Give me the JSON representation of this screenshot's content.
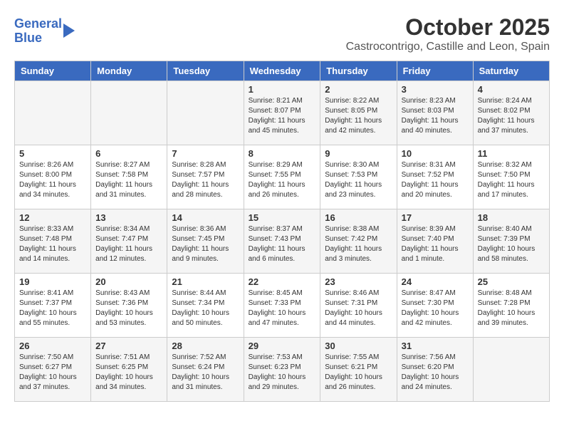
{
  "logo": {
    "line1": "General",
    "line2": "Blue"
  },
  "header": {
    "title": "October 2025",
    "subtitle": "Castrocontrigo, Castille and Leon, Spain"
  },
  "weekdays": [
    "Sunday",
    "Monday",
    "Tuesday",
    "Wednesday",
    "Thursday",
    "Friday",
    "Saturday"
  ],
  "weeks": [
    [
      {
        "day": "",
        "info": ""
      },
      {
        "day": "",
        "info": ""
      },
      {
        "day": "",
        "info": ""
      },
      {
        "day": "1",
        "info": "Sunrise: 8:21 AM\nSunset: 8:07 PM\nDaylight: 11 hours and 45 minutes."
      },
      {
        "day": "2",
        "info": "Sunrise: 8:22 AM\nSunset: 8:05 PM\nDaylight: 11 hours and 42 minutes."
      },
      {
        "day": "3",
        "info": "Sunrise: 8:23 AM\nSunset: 8:03 PM\nDaylight: 11 hours and 40 minutes."
      },
      {
        "day": "4",
        "info": "Sunrise: 8:24 AM\nSunset: 8:02 PM\nDaylight: 11 hours and 37 minutes."
      }
    ],
    [
      {
        "day": "5",
        "info": "Sunrise: 8:26 AM\nSunset: 8:00 PM\nDaylight: 11 hours and 34 minutes."
      },
      {
        "day": "6",
        "info": "Sunrise: 8:27 AM\nSunset: 7:58 PM\nDaylight: 11 hours and 31 minutes."
      },
      {
        "day": "7",
        "info": "Sunrise: 8:28 AM\nSunset: 7:57 PM\nDaylight: 11 hours and 28 minutes."
      },
      {
        "day": "8",
        "info": "Sunrise: 8:29 AM\nSunset: 7:55 PM\nDaylight: 11 hours and 26 minutes."
      },
      {
        "day": "9",
        "info": "Sunrise: 8:30 AM\nSunset: 7:53 PM\nDaylight: 11 hours and 23 minutes."
      },
      {
        "day": "10",
        "info": "Sunrise: 8:31 AM\nSunset: 7:52 PM\nDaylight: 11 hours and 20 minutes."
      },
      {
        "day": "11",
        "info": "Sunrise: 8:32 AM\nSunset: 7:50 PM\nDaylight: 11 hours and 17 minutes."
      }
    ],
    [
      {
        "day": "12",
        "info": "Sunrise: 8:33 AM\nSunset: 7:48 PM\nDaylight: 11 hours and 14 minutes."
      },
      {
        "day": "13",
        "info": "Sunrise: 8:34 AM\nSunset: 7:47 PM\nDaylight: 11 hours and 12 minutes."
      },
      {
        "day": "14",
        "info": "Sunrise: 8:36 AM\nSunset: 7:45 PM\nDaylight: 11 hours and 9 minutes."
      },
      {
        "day": "15",
        "info": "Sunrise: 8:37 AM\nSunset: 7:43 PM\nDaylight: 11 hours and 6 minutes."
      },
      {
        "day": "16",
        "info": "Sunrise: 8:38 AM\nSunset: 7:42 PM\nDaylight: 11 hours and 3 minutes."
      },
      {
        "day": "17",
        "info": "Sunrise: 8:39 AM\nSunset: 7:40 PM\nDaylight: 11 hours and 1 minute."
      },
      {
        "day": "18",
        "info": "Sunrise: 8:40 AM\nSunset: 7:39 PM\nDaylight: 10 hours and 58 minutes."
      }
    ],
    [
      {
        "day": "19",
        "info": "Sunrise: 8:41 AM\nSunset: 7:37 PM\nDaylight: 10 hours and 55 minutes."
      },
      {
        "day": "20",
        "info": "Sunrise: 8:43 AM\nSunset: 7:36 PM\nDaylight: 10 hours and 53 minutes."
      },
      {
        "day": "21",
        "info": "Sunrise: 8:44 AM\nSunset: 7:34 PM\nDaylight: 10 hours and 50 minutes."
      },
      {
        "day": "22",
        "info": "Sunrise: 8:45 AM\nSunset: 7:33 PM\nDaylight: 10 hours and 47 minutes."
      },
      {
        "day": "23",
        "info": "Sunrise: 8:46 AM\nSunset: 7:31 PM\nDaylight: 10 hours and 44 minutes."
      },
      {
        "day": "24",
        "info": "Sunrise: 8:47 AM\nSunset: 7:30 PM\nDaylight: 10 hours and 42 minutes."
      },
      {
        "day": "25",
        "info": "Sunrise: 8:48 AM\nSunset: 7:28 PM\nDaylight: 10 hours and 39 minutes."
      }
    ],
    [
      {
        "day": "26",
        "info": "Sunrise: 7:50 AM\nSunset: 6:27 PM\nDaylight: 10 hours and 37 minutes."
      },
      {
        "day": "27",
        "info": "Sunrise: 7:51 AM\nSunset: 6:25 PM\nDaylight: 10 hours and 34 minutes."
      },
      {
        "day": "28",
        "info": "Sunrise: 7:52 AM\nSunset: 6:24 PM\nDaylight: 10 hours and 31 minutes."
      },
      {
        "day": "29",
        "info": "Sunrise: 7:53 AM\nSunset: 6:23 PM\nDaylight: 10 hours and 29 minutes."
      },
      {
        "day": "30",
        "info": "Sunrise: 7:55 AM\nSunset: 6:21 PM\nDaylight: 10 hours and 26 minutes."
      },
      {
        "day": "31",
        "info": "Sunrise: 7:56 AM\nSunset: 6:20 PM\nDaylight: 10 hours and 24 minutes."
      },
      {
        "day": "",
        "info": ""
      }
    ]
  ]
}
